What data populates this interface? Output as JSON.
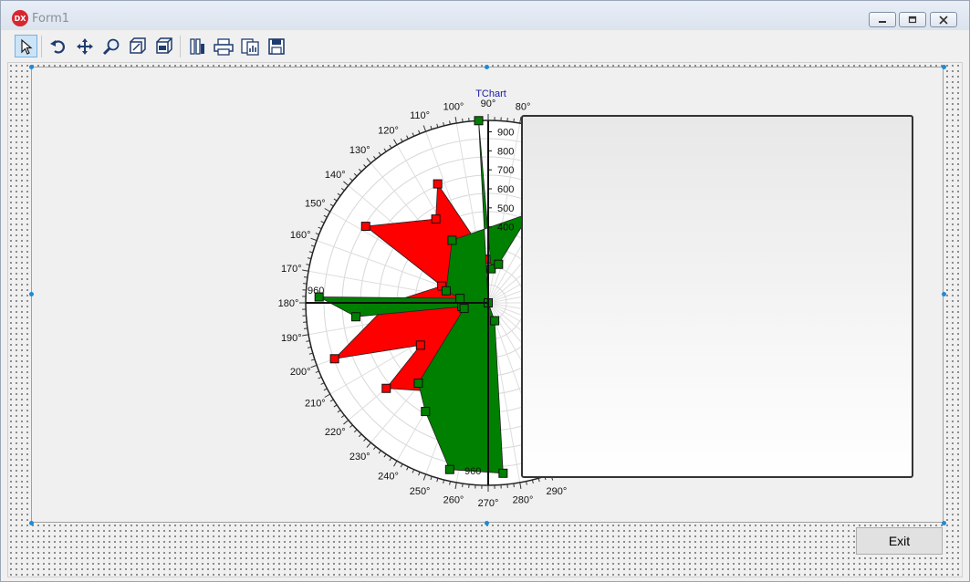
{
  "window": {
    "title": "Form1",
    "icon_text": "DX",
    "controls": [
      "minimize-icon",
      "restore-icon",
      "close-icon"
    ]
  },
  "toolbar": {
    "buttons": [
      {
        "name": "select-arrow-icon",
        "active": true
      },
      {
        "name": "rotate-icon"
      },
      {
        "name": "move-icon"
      },
      {
        "name": "zoom-icon"
      },
      {
        "name": "depth-icon"
      },
      {
        "name": "3d-icon"
      },
      {
        "name": "edit-chart-icon"
      },
      {
        "name": "print-icon"
      },
      {
        "name": "copy-icon"
      },
      {
        "name": "save-icon"
      }
    ]
  },
  "chart_data": {
    "type": "polar",
    "title": "TChart",
    "angle_unit": "degrees",
    "angle_labels": [
      "80°",
      "90°",
      "100°",
      "110°",
      "120°",
      "130°",
      "140°",
      "150°",
      "160°",
      "170°",
      "180°",
      "190°",
      "200°",
      "210°",
      "220°",
      "230°",
      "240°",
      "250°",
      "260°",
      "270°",
      "280°",
      "290°"
    ],
    "radius_tick_labels": [
      "400",
      "500",
      "600",
      "700",
      "800",
      "900"
    ],
    "axis_end_labels": {
      "left": "960",
      "bottom": "960"
    },
    "rlim": [
      0,
      960
    ],
    "grid": true,
    "colors": {
      "series_red": "#ff0000",
      "series_green": "#008000"
    },
    "series": [
      {
        "points": [
          {
            "angle": 90,
            "r": 230
          },
          {
            "angle": 113,
            "r": 680
          },
          {
            "angle": 122,
            "r": 520
          },
          {
            "angle": 148,
            "r": 760
          },
          {
            "angle": 160,
            "r": 260
          },
          {
            "angle": 180,
            "r": 520
          },
          {
            "angle": 200,
            "r": 860
          },
          {
            "angle": 212,
            "r": 420
          },
          {
            "angle": 220,
            "r": 700
          },
          {
            "angle": 236,
            "r": 560
          }
        ]
      },
      {
        "points": [
          {
            "angle": 93,
            "r": 960
          },
          {
            "angle": 85,
            "r": 180
          },
          {
            "angle": 75,
            "r": 210
          },
          {
            "angle": 65,
            "r": 520
          },
          {
            "angle": 120,
            "r": 380
          },
          {
            "angle": 164,
            "r": 230
          },
          {
            "angle": 171,
            "r": 150
          },
          {
            "angle": 178,
            "r": 890
          },
          {
            "angle": 186,
            "r": 700
          },
          {
            "angle": 188,
            "r": 140
          },
          {
            "angle": 193,
            "r": 130
          },
          {
            "angle": 229,
            "r": 560
          },
          {
            "angle": 240,
            "r": 660
          },
          {
            "angle": 257,
            "r": 900
          },
          {
            "angle": 275,
            "r": 900
          },
          {
            "angle": 290,
            "r": 100
          },
          {
            "angle": 270,
            "r": 0
          }
        ]
      }
    ]
  },
  "legend": {
    "entries": []
  },
  "exit_button": {
    "label": "Exit"
  }
}
